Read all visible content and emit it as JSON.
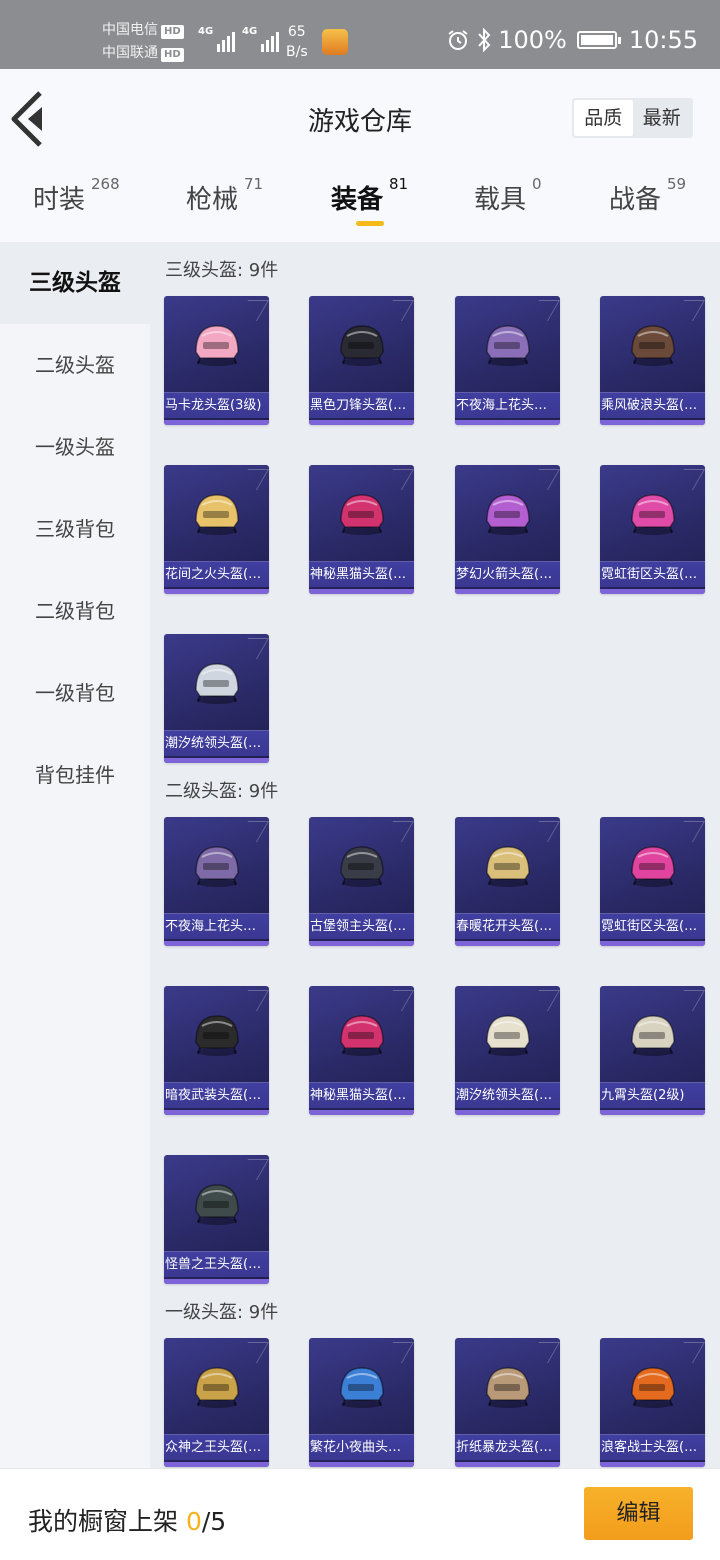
{
  "status_bar": {
    "carrier1": "中国电信",
    "carrier2": "中国联通",
    "hd": "HD",
    "net_type": "4G",
    "net_speed_value": "65",
    "net_speed_unit": "B/s",
    "battery": "100%",
    "time": "10:55"
  },
  "header": {
    "title": "游戏仓库",
    "sort_quality": "品质",
    "sort_newest": "最新"
  },
  "tabs": [
    {
      "label": "时装",
      "count": "268"
    },
    {
      "label": "枪械",
      "count": "71"
    },
    {
      "label": "装备",
      "count": "81"
    },
    {
      "label": "载具",
      "count": "0"
    },
    {
      "label": "战备",
      "count": "59"
    }
  ],
  "sidebar": [
    {
      "label": "三级头盔"
    },
    {
      "label": "二级头盔"
    },
    {
      "label": "一级头盔"
    },
    {
      "label": "三级背包"
    },
    {
      "label": "二级背包"
    },
    {
      "label": "一级背包"
    },
    {
      "label": "背包挂件"
    }
  ],
  "sections": [
    {
      "title": "三级头盔: 9件",
      "items": [
        {
          "name": "马卡龙头盔(3级)",
          "color": "#f2a7c3"
        },
        {
          "name": "黑色刀锋头盔(…",
          "color": "#2a2a33"
        },
        {
          "name": "不夜海上花头…",
          "color": "#8a6fb8"
        },
        {
          "name": "乘风破浪头盔(…",
          "color": "#6b4a3a"
        },
        {
          "name": "花间之火头盔(…",
          "color": "#e8c26a"
        },
        {
          "name": "神秘黑猫头盔(…",
          "color": "#d2336f"
        },
        {
          "name": "梦幻火箭头盔(…",
          "color": "#b35fd1"
        },
        {
          "name": "霓虹街区头盔(…",
          "color": "#e14ba8"
        },
        {
          "name": "潮汐统领头盔(…",
          "color": "#cfd6e0"
        }
      ]
    },
    {
      "title": "二级头盔: 9件",
      "items": [
        {
          "name": "不夜海上花头…",
          "color": "#7d6aa6"
        },
        {
          "name": "古堡领主头盔(…",
          "color": "#3a3d48"
        },
        {
          "name": "春暖花开头盔(…",
          "color": "#d9bf7a"
        },
        {
          "name": "霓虹街区头盔(…",
          "color": "#e0449f"
        },
        {
          "name": "暗夜武装头盔(…",
          "color": "#2b2b2b"
        },
        {
          "name": "神秘黑猫头盔(…",
          "color": "#d2336f"
        },
        {
          "name": "潮汐统领头盔(…",
          "color": "#e6e0cf"
        },
        {
          "name": "九霄头盔(2级)",
          "color": "#d8d2c0"
        },
        {
          "name": "怪兽之王头盔(…",
          "color": "#3f4a4a"
        }
      ]
    },
    {
      "title": "一级头盔: 9件",
      "items": [
        {
          "name": "众神之王头盔(…",
          "color": "#c9a24a"
        },
        {
          "name": "繁花小夜曲头…",
          "color": "#3c7fd6"
        },
        {
          "name": "折纸暴龙头盔(…",
          "color": "#b89a78"
        },
        {
          "name": "浪客战士头盔(…",
          "color": "#e46a1f"
        }
      ]
    }
  ],
  "footer": {
    "label": "我的橱窗上架",
    "current": "0",
    "total": "/5",
    "edit_button": "编辑"
  },
  "colors": {
    "accent": "#f6b91a",
    "card_bg": "#2d2b6e",
    "card_label_bg": "#3d3b99"
  }
}
